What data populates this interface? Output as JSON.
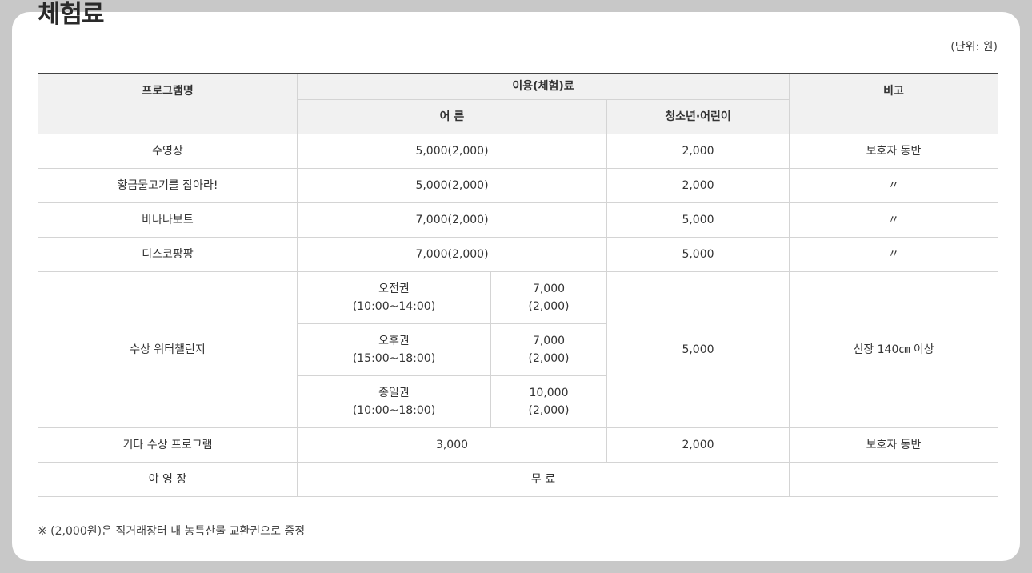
{
  "title": "체험료",
  "unit": "(단위: 원)",
  "header": {
    "program": "프로그램명",
    "fee": "이용(체험)료",
    "note": "비고",
    "adult": "어 른",
    "youth": "청소년·어린이"
  },
  "rows": [
    {
      "program": "수영장",
      "adult": "5,000(2,000)",
      "youth": "2,000",
      "note": "보호자 동반"
    },
    {
      "program": "황금물고기를 잡아라!",
      "adult": "5,000(2,000)",
      "youth": "2,000",
      "note": "〃"
    },
    {
      "program": "바나나보트",
      "adult": "7,000(2,000)",
      "youth": "5,000",
      "note": "〃"
    },
    {
      "program": "디스코팡팡",
      "adult": "7,000(2,000)",
      "youth": "5,000",
      "note": "〃"
    }
  ],
  "water": {
    "program": "수상 워터챌린지",
    "youth": "5,000",
    "note": "신장 140㎝ 이상",
    "tickets": [
      {
        "name": "오전권",
        "time": "(10:00~14:00)",
        "price": "7,000",
        "sub": "(2,000)"
      },
      {
        "name": "오후권",
        "time": "(15:00~18:00)",
        "price": "7,000",
        "sub": "(2,000)"
      },
      {
        "name": "종일권",
        "time": "(10:00~18:00)",
        "price": "10,000",
        "sub": "(2,000)"
      }
    ]
  },
  "other": {
    "program": "기타 수상 프로그램",
    "adult": "3,000",
    "youth": "2,000",
    "note": "보호자 동반"
  },
  "camp": {
    "program": "야 영 장",
    "fee": "무 료",
    "note": ""
  },
  "footnote": "※ (2,000원)은 직거래장터 내 농특산물 교환권으로 증정"
}
